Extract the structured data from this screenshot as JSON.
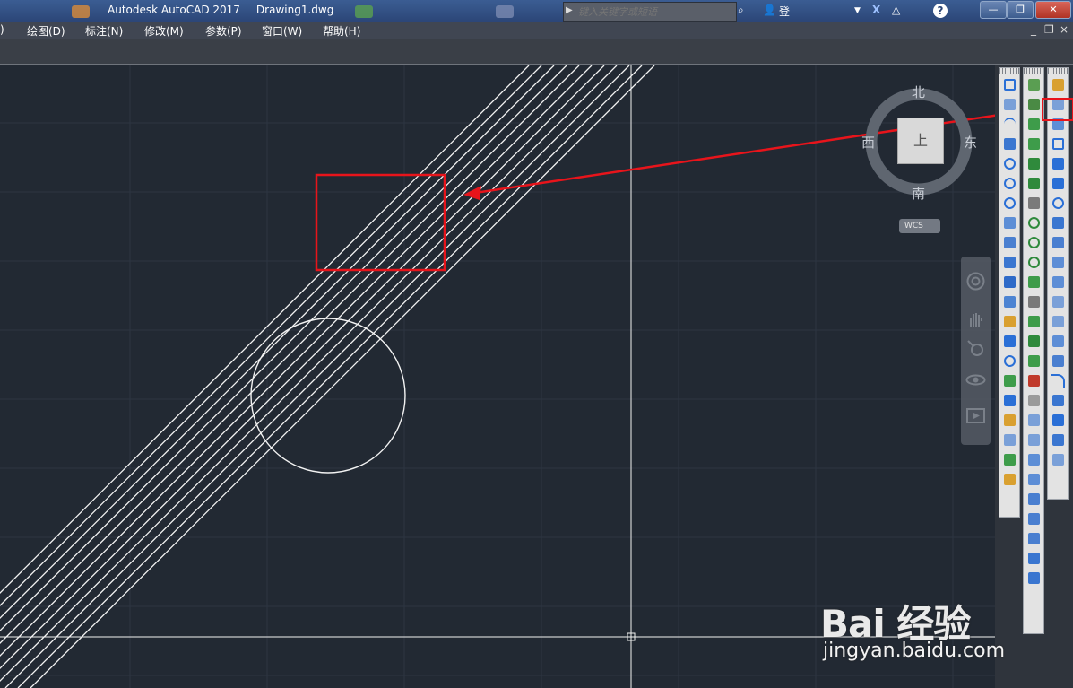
{
  "window": {
    "app_name": "Autodesk AutoCAD 2017",
    "document_name": "Drawing1.dwg",
    "search_placeholder": "键入关键字或短语",
    "sign_in_label": "登录",
    "min_icon": "minimize-icon",
    "max_icon": "restore-icon",
    "close_icon": "close-icon"
  },
  "menubar": {
    "items": [
      {
        "label": ")"
      },
      {
        "label": "绘图(D)"
      },
      {
        "label": "标注(N)"
      },
      {
        "label": "修改(M)"
      },
      {
        "label": "参数(P)"
      },
      {
        "label": "窗口(W)"
      },
      {
        "label": "帮助(H)"
      }
    ]
  },
  "viewcube": {
    "north": "北",
    "south": "南",
    "east": "东",
    "west": "西",
    "top_face": "上",
    "ucs_label": "WCS"
  },
  "colors": {
    "canvas_bg": "#222933",
    "annotation_red": "#e8141b",
    "geometry_white": "#ffffff"
  },
  "watermark": {
    "logo_text": "Bai 经验",
    "url": "jingyan.baidu.com"
  }
}
